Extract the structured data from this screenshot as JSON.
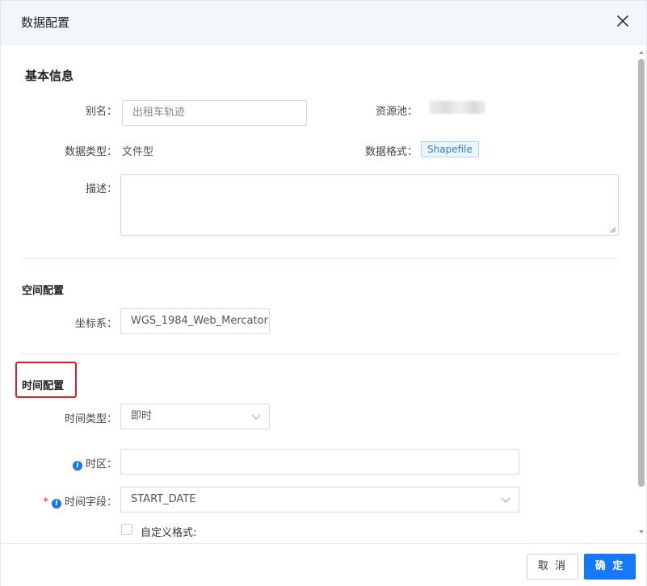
{
  "dialog": {
    "title": "数据配置"
  },
  "basic": {
    "section_title": "基本信息",
    "alias_label": "别名：",
    "alias_placeholder": "出租车轨迹",
    "resource_pool_label": "资源池：",
    "data_type_label": "数据类型：",
    "data_type_value": "文件型",
    "data_format_label": "数据格式：",
    "data_format_value": "Shapefile",
    "description_label": "描述："
  },
  "spatial": {
    "section_title": "空间配置",
    "crs_label": "坐标系：",
    "crs_value": "WGS_1984_Web_Mercator"
  },
  "time": {
    "section_title": "时间配置",
    "time_type_label": "时间类型：",
    "time_type_value": "即时",
    "timezone_label": "时区：",
    "time_field_label": "时间字段：",
    "time_field_value": "START_DATE",
    "custom_format_label": "自定义格式:"
  },
  "footer": {
    "cancel_label": "取 消",
    "ok_label": "确 定"
  },
  "colors": {
    "primary": "#1677ff",
    "highlight": "#e02020",
    "tag_bg": "#ecf5ff"
  }
}
